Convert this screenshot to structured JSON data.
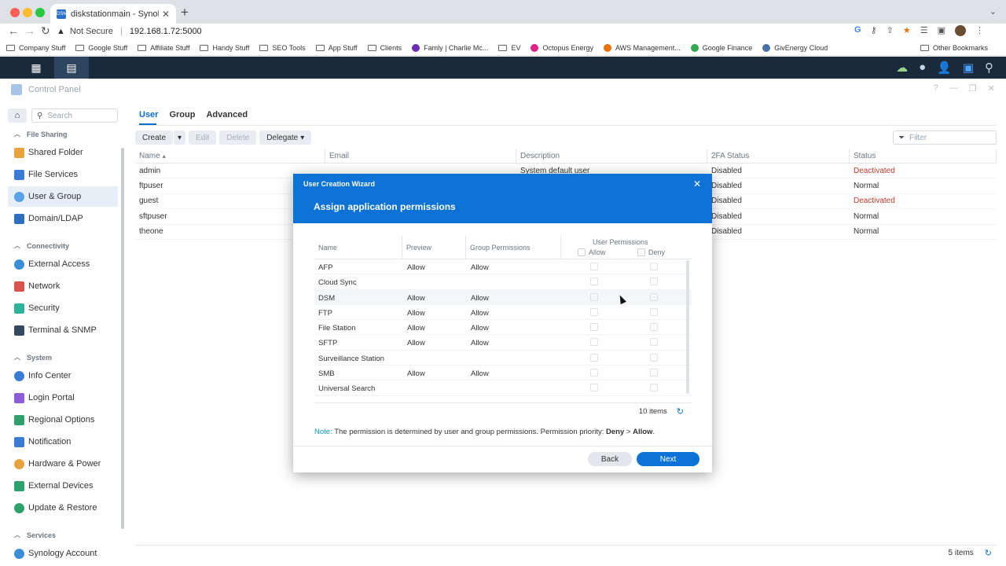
{
  "browser": {
    "tab_title": "diskstationmain - Synology NAS",
    "tab_favicon": "DSM",
    "security_label": "Not Secure",
    "url": "192.168.1.72:5000",
    "bookmarks": [
      "Company Stuff",
      "Google Stuff",
      "Affiliate Stuff",
      "Handy Stuff",
      "SEO Tools",
      "App Stuff",
      "Clients",
      "Famly | Charlie Mc...",
      "EV",
      "Octopus Energy",
      "AWS Management...",
      "Google Finance",
      "GivEnergy Cloud"
    ],
    "other_bookmarks": "Other Bookmarks"
  },
  "control_panel": {
    "title": "Control Panel",
    "search_placeholder": "Search",
    "sections": {
      "file_sharing": "File Sharing",
      "connectivity": "Connectivity",
      "system": "System",
      "services": "Services"
    },
    "items": {
      "shared_folder": "Shared Folder",
      "file_services": "File Services",
      "user_group": "User & Group",
      "domain_ldap": "Domain/LDAP",
      "external_access": "External Access",
      "network": "Network",
      "security": "Security",
      "terminal_snmp": "Terminal & SNMP",
      "info_center": "Info Center",
      "login_portal": "Login Portal",
      "regional_options": "Regional Options",
      "notification": "Notification",
      "hardware_power": "Hardware & Power",
      "external_devices": "External Devices",
      "update_restore": "Update & Restore",
      "synology_account": "Synology Account"
    }
  },
  "main": {
    "tabs": [
      "User",
      "Group",
      "Advanced"
    ],
    "actions": {
      "create": "Create",
      "edit": "Edit",
      "delete": "Delete",
      "delegate": "Delegate"
    },
    "filter_placeholder": "Filter",
    "columns": [
      "Name",
      "Email",
      "Description",
      "2FA Status",
      "Status"
    ],
    "rows": [
      {
        "name": "admin",
        "email": "",
        "description": "System default user",
        "tfa": "Disabled",
        "status": "Deactivated"
      },
      {
        "name": "ftpuser",
        "email": "",
        "description": "",
        "tfa": "Disabled",
        "status": "Normal"
      },
      {
        "name": "guest",
        "email": "",
        "description": "",
        "tfa": "Disabled",
        "status": "Deactivated"
      },
      {
        "name": "sftpuser",
        "email": "",
        "description": "",
        "tfa": "Disabled",
        "status": "Normal"
      },
      {
        "name": "theone",
        "email": "",
        "description": "",
        "tfa": "Disabled",
        "status": "Normal"
      }
    ],
    "items_count": "5 items"
  },
  "wizard": {
    "window_title": "User Creation Wizard",
    "step_title": "Assign application permissions",
    "columns": {
      "name": "Name",
      "preview": "Preview",
      "group": "Group Permissions",
      "user": "User Permissions",
      "allow": "Allow",
      "deny": "Deny"
    },
    "rows": [
      {
        "name": "AFP",
        "preview": "Allow",
        "group": "Allow"
      },
      {
        "name": "Cloud Sync",
        "preview": "",
        "group": ""
      },
      {
        "name": "DSM",
        "preview": "Allow",
        "group": "Allow"
      },
      {
        "name": "FTP",
        "preview": "Allow",
        "group": "Allow"
      },
      {
        "name": "File Station",
        "preview": "Allow",
        "group": "Allow"
      },
      {
        "name": "SFTP",
        "preview": "Allow",
        "group": "Allow"
      },
      {
        "name": "Surveillance Station",
        "preview": "",
        "group": ""
      },
      {
        "name": "SMB",
        "preview": "Allow",
        "group": "Allow"
      },
      {
        "name": "Universal Search",
        "preview": "",
        "group": ""
      }
    ],
    "items_count": "10 items",
    "note": {
      "label": "Note:",
      "text": "The permission is determined by user and group permissions. Permission priority:",
      "deny": "Deny",
      "gt": ">",
      "allow": "Allow",
      "end": "."
    },
    "back": "Back",
    "next": "Next"
  }
}
